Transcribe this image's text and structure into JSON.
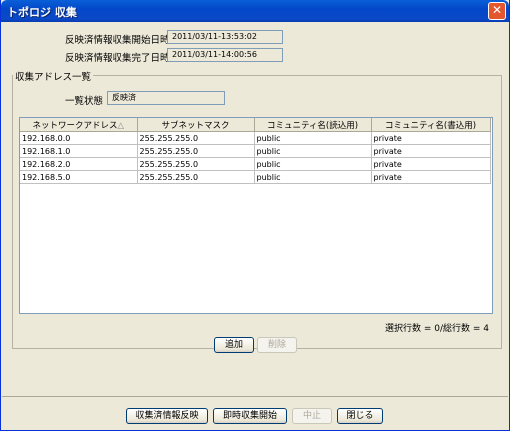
{
  "window": {
    "title": "トポロジ 収集",
    "close": "✕"
  },
  "fields": {
    "start_label": "反映済情報収集開始日時",
    "start_value": "2011/03/11-13:53:02",
    "end_label": "反映済情報収集完了日時",
    "end_value": "2011/03/11-14:00:56"
  },
  "group": {
    "title": "収集アドレス一覧",
    "status_label": "一覧状態",
    "status_value": "反映済"
  },
  "table": {
    "columns": [
      "ネットワークアドレス",
      "サブネットマスク",
      "コミュニティ名(読込用)",
      "コミュニティ名(書込用)"
    ],
    "sort_indicator": "△",
    "rows": [
      [
        "192.168.0.0",
        "255.255.255.0",
        "public",
        "private"
      ],
      [
        "192.168.1.0",
        "255.255.255.0",
        "public",
        "private"
      ],
      [
        "192.168.2.0",
        "255.255.255.0",
        "public",
        "private"
      ],
      [
        "192.168.5.0",
        "255.255.255.0",
        "public",
        "private"
      ]
    ]
  },
  "count_text": "選択行数 = 0/総行数 = 4",
  "buttons": {
    "add": "追加",
    "delete": "削除",
    "reflect": "収集済情報反映",
    "start_now": "即時収集開始",
    "stop": "中止",
    "close": "閉じる"
  }
}
